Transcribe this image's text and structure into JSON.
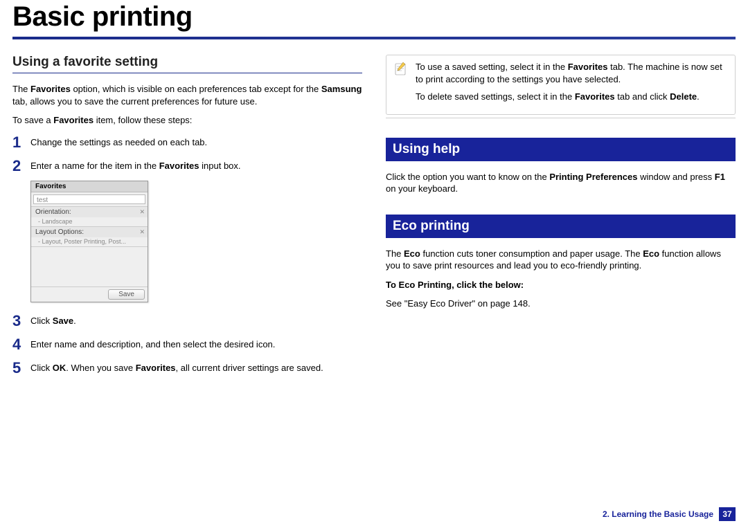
{
  "title": "Basic printing",
  "left": {
    "heading": "Using a favorite setting",
    "intro_parts": [
      "The ",
      "Favorites",
      " option, which is visible on each preferences tab except for the ",
      "Samsung",
      " tab, allows you to save the current preferences for future use."
    ],
    "save_intro_parts": [
      "To save a ",
      "Favorites",
      " item, follow these steps:"
    ],
    "steps": {
      "s1": "Change the settings as needed on each tab.",
      "s2_parts": [
        "Enter a name for the item in the ",
        "Favorites",
        " input box."
      ],
      "s3_parts": [
        "Click ",
        "Save",
        "."
      ],
      "s4": "Enter name and description, and then select the desired icon.",
      "s5_parts": [
        "Click ",
        "OK",
        ". When you save ",
        "Favorites",
        ", all current driver settings are saved."
      ]
    },
    "widget": {
      "header": "Favorites",
      "input_value": "test",
      "row1_label": "Orientation:",
      "row1_sub": "- Landscape",
      "row2_label": "Layout Options:",
      "row2_sub": "- Layout, Poster Printing, Post...",
      "save_btn": "Save"
    }
  },
  "right": {
    "note_p1_parts": [
      "To use a saved setting, select it in the ",
      "Favorites",
      " tab. The machine is now set to print according to the settings you have selected."
    ],
    "note_p2_parts": [
      "To delete saved settings, select it in the  ",
      "Favorites",
      " tab and click ",
      "Delete",
      "."
    ],
    "help_heading": "Using help",
    "help_body_parts": [
      "Click the option you want to know on the ",
      "Printing Preferences",
      " window and press ",
      "F1",
      " on your keyboard."
    ],
    "eco_heading": "Eco printing",
    "eco_body_parts": [
      "The ",
      "Eco",
      " function cuts toner consumption and paper usage. The ",
      "Eco",
      " function allows you to save print resources and lead you to eco-friendly printing."
    ],
    "eco_sub": "To Eco Printing, click the below:",
    "eco_ref": "See \"Easy Eco Driver\" on page 148."
  },
  "footer": {
    "chapter": "2. Learning the Basic Usage",
    "page": "37"
  }
}
